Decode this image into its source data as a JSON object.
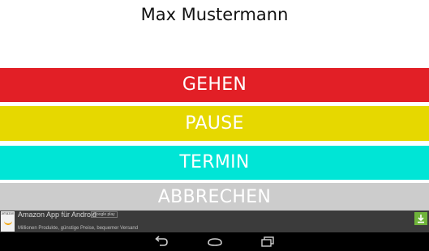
{
  "header": {
    "user_name": "Max Mustermann"
  },
  "actions": [
    {
      "label": "GEHEN",
      "color": "#e21f26"
    },
    {
      "label": "PAUSE",
      "color": "#e6d800"
    },
    {
      "label": "TERMIN",
      "color": "#00e5d6"
    },
    {
      "label": "ABBRECHEN",
      "color": "#cccccc"
    }
  ],
  "ad": {
    "logo_text": "amazon",
    "title": "Amazon App für Android",
    "store_badge": "Google play",
    "subtitle": "Millionen Produkte, günstige Preise, bequemer Versand",
    "download_icon": "download-icon",
    "background": "#3b3b3b",
    "download_color": "#6fb43a"
  },
  "nav": {
    "back_icon": "back-icon",
    "home_icon": "home-icon",
    "recent_icon": "recent-apps-icon"
  }
}
